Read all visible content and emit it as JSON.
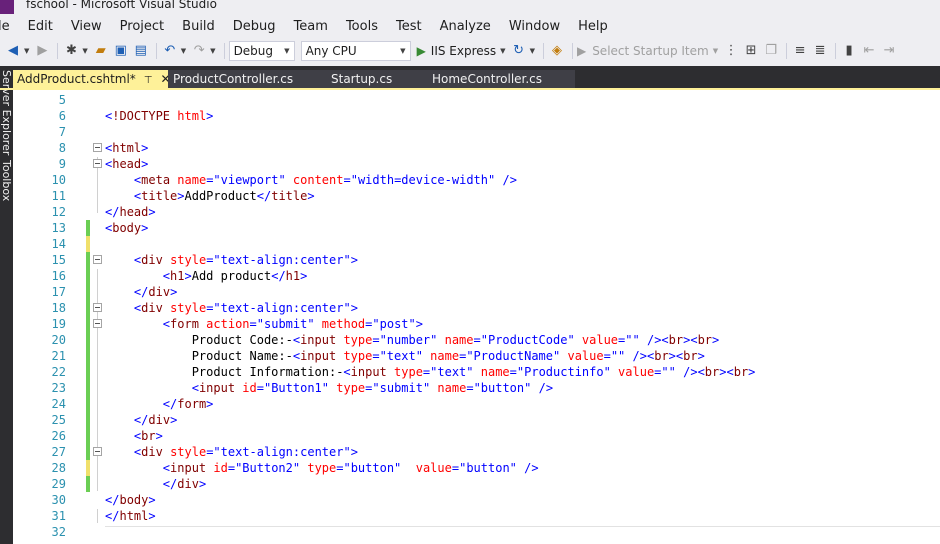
{
  "window": {
    "title": "fschool - Microsoft Visual Studio"
  },
  "menu": [
    "le",
    "Edit",
    "View",
    "Project",
    "Build",
    "Debug",
    "Team",
    "Tools",
    "Test",
    "Analyze",
    "Window",
    "Help"
  ],
  "toolbar": {
    "config": "Debug",
    "platform": "Any CPU",
    "run_label": "IIS Express",
    "startup_label": "Select Startup Item"
  },
  "side": {
    "label1": "Server Explorer",
    "label2": "Toolbox"
  },
  "tabs": [
    {
      "label": "AddProduct.cshtml*",
      "pin": "⊤",
      "close": "✕"
    },
    {
      "label": "ProductController.cs"
    },
    {
      "label": "Startup.cs"
    },
    {
      "label": "HomeController.cs"
    }
  ],
  "code": [
    {
      "n": "5",
      "text": ""
    },
    {
      "n": "6",
      "text": "<!DOCTYPE html>"
    },
    {
      "n": "7",
      "text": ""
    },
    {
      "n": "8",
      "text": "<html>"
    },
    {
      "n": "9",
      "text": "<head>"
    },
    {
      "n": "10",
      "text": "    <meta name=\"viewport\" content=\"width=device-width\" />"
    },
    {
      "n": "11",
      "text": "    <title>AddProduct</title>"
    },
    {
      "n": "12",
      "text": "</head>"
    },
    {
      "n": "13",
      "text": "<body>"
    },
    {
      "n": "14",
      "text": ""
    },
    {
      "n": "15",
      "text": "    <div style=\"text-align:center\">"
    },
    {
      "n": "16",
      "text": "        <h1>Add product</h1>"
    },
    {
      "n": "17",
      "text": "    </div>"
    },
    {
      "n": "18",
      "text": "    <div style=\"text-align:center\">"
    },
    {
      "n": "19",
      "text": "        <form action=\"submit\" method=\"post\">"
    },
    {
      "n": "20",
      "text": "            Product Code:-<input type=\"number\" name=\"ProductCode\" value=\"\" /><br><br>"
    },
    {
      "n": "21",
      "text": "            Product Name:-<input type=\"text\" name=\"ProductName\" value=\"\" /><br><br>"
    },
    {
      "n": "22",
      "text": "            Product Information:-<input type=\"text\" name=\"Productinfo\" value=\"\" /><br><br>"
    },
    {
      "n": "23",
      "text": "            <input id=\"Button1\" type=\"submit\" name=\"button\" />"
    },
    {
      "n": "24",
      "text": "        </form>"
    },
    {
      "n": "25",
      "text": "    </div>"
    },
    {
      "n": "26",
      "text": "    <br>"
    },
    {
      "n": "27",
      "text": "    <div style=\"text-align:center\">"
    },
    {
      "n": "28",
      "text": "        <input id=\"Button2\" type=\"button\"  value=\"button\" />"
    },
    {
      "n": "29",
      "text": "        </div>"
    },
    {
      "n": "30",
      "text": "</body>"
    },
    {
      "n": "31",
      "text": "</html>"
    },
    {
      "n": "32",
      "text": ""
    }
  ]
}
